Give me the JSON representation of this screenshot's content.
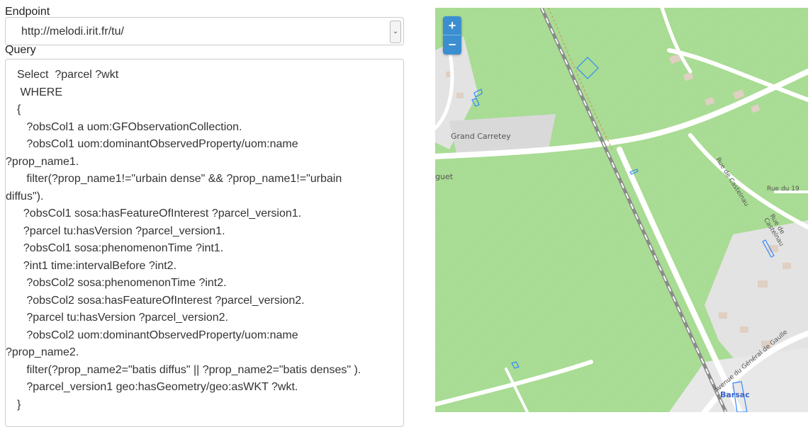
{
  "form": {
    "endpoint_label": "Endpoint",
    "endpoint_value": "http://melodi.irit.fr/tu/",
    "query_label": "Query",
    "query_lines": [
      {
        "text": "Select  ?parcel ?wkt",
        "wrap": false
      },
      {
        "text": " WHERE",
        "wrap": false
      },
      {
        "text": "{",
        "wrap": false
      },
      {
        "text": "   ?obsCol1 a uom:GFObservationCollection.",
        "wrap": false
      },
      {
        "text": "   ?obsCol1 uom:dominantObservedProperty/uom:name",
        "wrap": false
      },
      {
        "text": "?prop_name1.",
        "wrap": true
      },
      {
        "text": "   filter(?prop_name1!=\"urbain dense\" && ?prop_name1!=\"urbain",
        "wrap": false
      },
      {
        "text": "diffus\").",
        "wrap": true
      },
      {
        "text": "  ?obsCol1 sosa:hasFeatureOfInterest ?parcel_version1.",
        "wrap": false
      },
      {
        "text": "  ?parcel tu:hasVersion ?parcel_version1.",
        "wrap": false
      },
      {
        "text": "  ?obsCol1 sosa:phenomenonTime ?int1.",
        "wrap": false
      },
      {
        "text": "  ?int1 time:intervalBefore ?int2.",
        "wrap": false
      },
      {
        "text": "   ?obsCol2 sosa:phenomenonTime ?int2.",
        "wrap": false
      },
      {
        "text": "   ?obsCol2 sosa:hasFeatureOfInterest ?parcel_version2.",
        "wrap": false
      },
      {
        "text": "   ?parcel tu:hasVersion ?parcel_version2.",
        "wrap": false
      },
      {
        "text": "   ?obsCol2 uom:dominantObservedProperty/uom:name",
        "wrap": false
      },
      {
        "text": "?prop_name2.",
        "wrap": true
      },
      {
        "text": "   filter(?prop_name2=\"batis diffus\" || ?prop_name2=\"batis denses\" ).",
        "wrap": false
      },
      {
        "text": "   ?parcel_version1 geo:hasGeometry/geo:asWKT ?wkt.",
        "wrap": false
      },
      {
        "text": "}",
        "wrap": false
      }
    ]
  },
  "map": {
    "zoom_in": "+",
    "zoom_out": "−",
    "labels": {
      "grand_carretey": "Grand Carretey",
      "guet": "guet",
      "rue_de_castelnau_1": "Rue de Castelnau",
      "rue_de_castelnau_2": "Rue de Castelnau",
      "rue_du": "Rue du 19",
      "avenue": "Avenue du Général de Gaulle",
      "town": "Barsac"
    },
    "colors": {
      "field": "#a9dc94",
      "road": "#ffffff",
      "built": "#e0d6cc",
      "railway": "#808080",
      "parcel": "#3388ff"
    }
  }
}
